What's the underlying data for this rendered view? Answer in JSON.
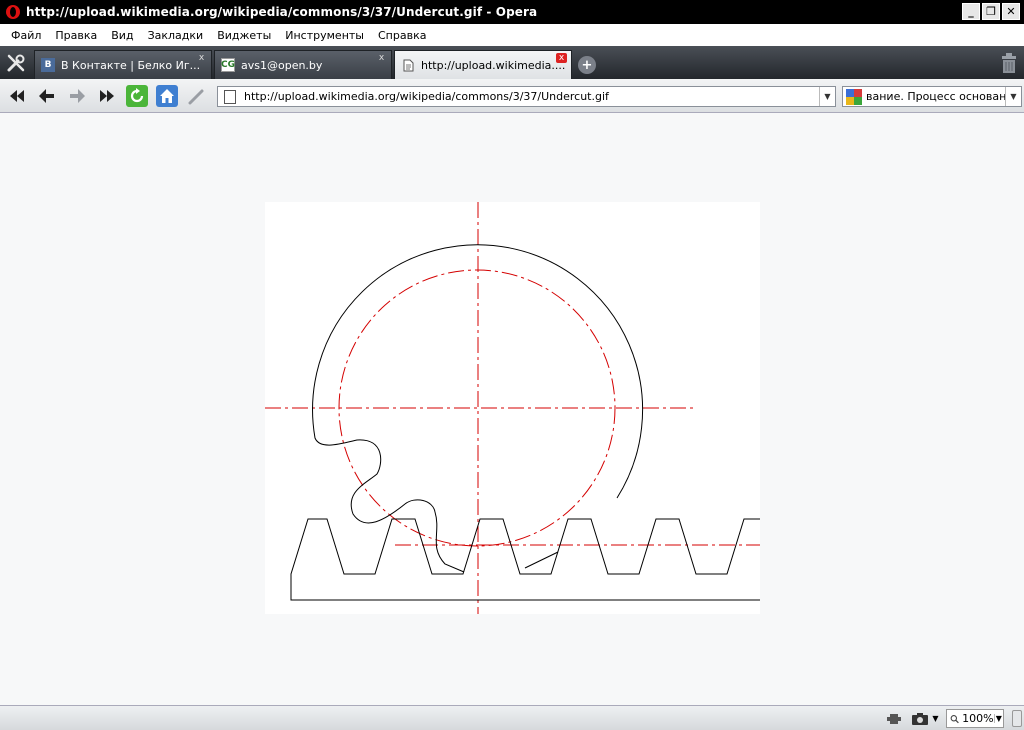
{
  "window": {
    "title": "http://upload.wikimedia.org/wikipedia/commons/3/37/Undercut.gif - Opera",
    "minimize": "_",
    "restore": "❐",
    "close": "✕"
  },
  "menu": {
    "items": [
      "Файл",
      "Правка",
      "Вид",
      "Закладки",
      "Виджеты",
      "Инструменты",
      "Справка"
    ]
  },
  "tabs": [
    {
      "label": "В Контакте | Белко Иг...",
      "favicon": "В",
      "close": "x"
    },
    {
      "label": "avs1@open.by",
      "favicon": "CG",
      "close": "x"
    },
    {
      "label": "http://upload.wikimedia....",
      "favicon": "",
      "close": "x"
    }
  ],
  "address": {
    "url": "http://upload.wikimedia.org/wikipedia/commons/3/37/Undercut.gif",
    "search_text": "вание. Процесс основан на"
  },
  "status": {
    "zoom": "100%"
  },
  "colors": {
    "accent_red": "#d40000",
    "tab_close_active": "#dd2222",
    "titlebar": "#000000"
  }
}
